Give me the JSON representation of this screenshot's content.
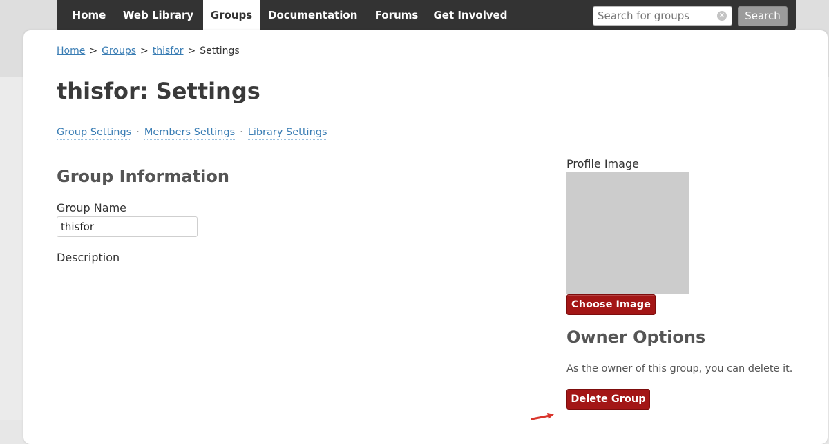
{
  "nav": {
    "items": [
      {
        "label": "Home"
      },
      {
        "label": "Web Library"
      },
      {
        "label": "Groups"
      },
      {
        "label": "Documentation"
      },
      {
        "label": "Forums"
      },
      {
        "label": "Get Involved"
      }
    ],
    "active_index": 2,
    "search": {
      "placeholder": "Search for groups",
      "value": "",
      "button_label": "Search"
    }
  },
  "breadcrumb": {
    "items": [
      {
        "label": "Home"
      },
      {
        "label": "Groups"
      },
      {
        "label": "thisfor"
      }
    ],
    "current": "Settings",
    "separator": ">"
  },
  "page": {
    "title": "thisfor: Settings"
  },
  "subnav": {
    "items": [
      {
        "label": "Group Settings"
      },
      {
        "label": "Members Settings"
      },
      {
        "label": "Library Settings"
      }
    ],
    "separator": "·"
  },
  "group_info": {
    "heading": "Group Information",
    "name_label": "Group Name",
    "name_value": "thisfor",
    "description_label": "Description"
  },
  "profile": {
    "label": "Profile Image",
    "choose_button": "Choose Image"
  },
  "owner": {
    "heading": "Owner Options",
    "note": "As the owner of this group, you can delete it.",
    "delete_button": "Delete Group"
  },
  "colors": {
    "nav_bg": "#333333",
    "link": "#3a7db4",
    "danger_button": "#a31616",
    "placeholder_image": "#cccccc"
  }
}
